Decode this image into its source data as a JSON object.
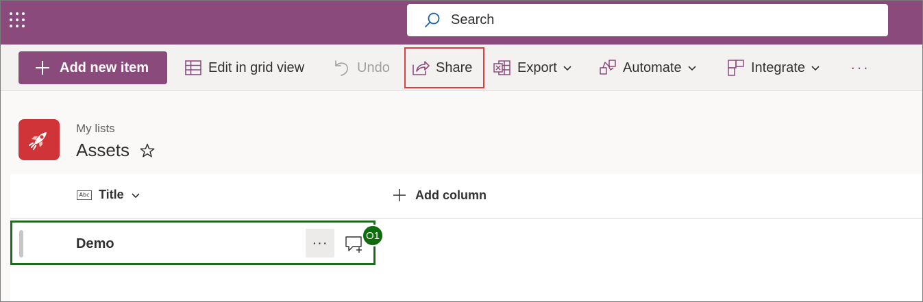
{
  "suite_bar": {
    "search_label": "Search"
  },
  "command_bar": {
    "add_new_item": "Add new item",
    "edit_grid": "Edit in grid view",
    "undo": "Undo",
    "share": "Share",
    "export": "Export",
    "automate": "Automate",
    "integrate": "Integrate",
    "more": "···"
  },
  "header": {
    "breadcrumb": "My lists",
    "title": "Assets"
  },
  "list": {
    "columns": [
      {
        "label": "Title",
        "type_badge": "Abc"
      }
    ],
    "add_column": "Add column",
    "rows": [
      {
        "title": "Demo",
        "more": "···"
      }
    ]
  },
  "annotations": {
    "step_badge": "O1"
  },
  "colors": {
    "brand": "#8b4a7c",
    "list_icon": "#d13438",
    "highlight_red": "#e23d3d",
    "highlight_green": "#1d6b1d"
  }
}
